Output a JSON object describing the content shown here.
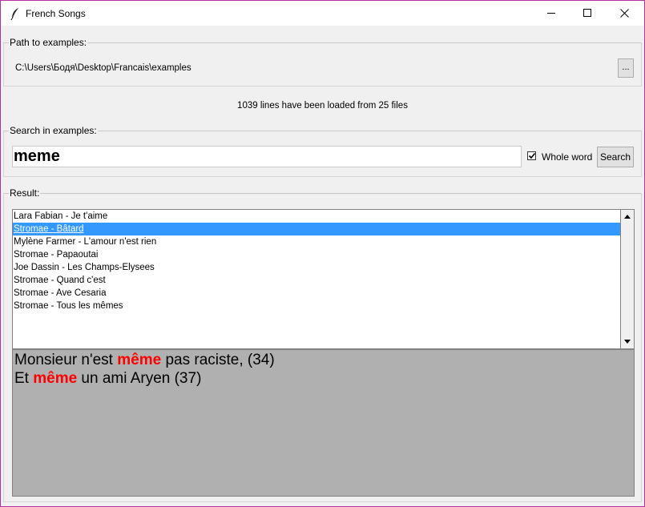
{
  "window": {
    "title": "French Songs",
    "app_icon": "feather-icon",
    "controls": [
      "minimize-icon",
      "maximize-icon",
      "close-icon"
    ]
  },
  "path_section": {
    "legend": "Path to examples:",
    "path": "C:\\Users\\Бодя\\Desktop\\Francais\\examples",
    "browse_label": "..."
  },
  "status": "1039 lines have been loaded from 25 files",
  "search_section": {
    "legend": "Search in examples:",
    "query": "meme",
    "whole_word_label": "Whole word",
    "whole_word_checked": true,
    "search_button": "Search"
  },
  "result_section": {
    "legend": "Result:",
    "items": [
      "Lara Fabian - Je t'aime",
      "Stromae - Bâtard",
      "Mylène Farmer - L'amour n'est rien",
      "Stromae - Papaoutai",
      "Joe Dassin - Les Champs-Elysees",
      "Stromae - Quand c'est",
      "Stromae - Ave Cesaria",
      "Stromae - Tous les mêmes"
    ],
    "selected_index": 1,
    "lines": [
      {
        "before": "Monsieur n'est ",
        "match": "même",
        "after": " pas raciste, (34)"
      },
      {
        "before": "Et ",
        "match": "même",
        "after": " un ami Aryen (37)"
      }
    ],
    "highlight_color": "#ff0000"
  }
}
